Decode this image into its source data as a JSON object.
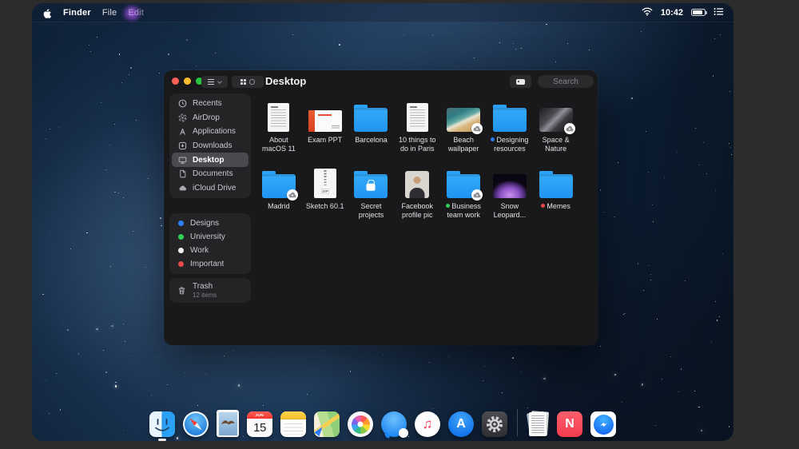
{
  "menu_bar": {
    "left_items": [
      {
        "label": "Finder",
        "bold": true
      },
      {
        "label": "File"
      },
      {
        "label": "Edit"
      }
    ],
    "time": "10:42"
  },
  "finder_window": {
    "title": "Desktop",
    "toolbar": {
      "search_placeholder": "Search"
    },
    "sidebar": {
      "places": [
        {
          "label": "Recents",
          "icon": "clock-icon"
        },
        {
          "label": "AirDrop",
          "icon": "airdrop-icon"
        },
        {
          "label": "Applications",
          "icon": "applications-icon"
        },
        {
          "label": "Downloads",
          "icon": "downloads-icon"
        },
        {
          "label": "Desktop",
          "icon": "desktop-icon",
          "selected": true
        },
        {
          "label": "Documents",
          "icon": "documents-icon"
        },
        {
          "label": "iCloud Drive",
          "icon": "icloud-icon"
        }
      ],
      "tags": [
        {
          "label": "Designs",
          "color": "#2c7ef8"
        },
        {
          "label": "University",
          "color": "#30d158"
        },
        {
          "label": "Work",
          "color": "#f2f2f4"
        },
        {
          "label": "Important",
          "color": "#e8484a"
        }
      ],
      "trash": {
        "label": "Trash",
        "count": "12 items",
        "icon": "trash-icon"
      }
    },
    "files": [
      {
        "label": "About macOS 11",
        "type": "document"
      },
      {
        "label": "Exam PPT",
        "type": "presentation"
      },
      {
        "label": "Barcelona",
        "type": "folder"
      },
      {
        "label": "10 things to do in Paris",
        "type": "document"
      },
      {
        "label": "Beach wallpaper",
        "type": "image-beach",
        "badge": "icloud-download"
      },
      {
        "label": "Designing resources",
        "type": "folder",
        "tag": "#2c7ef8"
      },
      {
        "label": "Space & Nature",
        "type": "image-space",
        "badge": "icloud-download"
      },
      {
        "label": "Madrid",
        "type": "folder",
        "badge": "icloud-download"
      },
      {
        "label": "Sketch 60.1",
        "type": "zip"
      },
      {
        "label": "Secret projects",
        "type": "folder-lock"
      },
      {
        "label": "Facebook profile pic",
        "type": "image-person"
      },
      {
        "label": "Business team work",
        "type": "folder",
        "badge": "icloud-download",
        "tag": "#30d158"
      },
      {
        "label": "Snow Leopard...",
        "type": "image-aurora"
      },
      {
        "label": "Memes",
        "type": "folder",
        "tag": "#e8484a"
      }
    ]
  },
  "dock": {
    "items": [
      {
        "name": "finder",
        "running": true
      },
      {
        "name": "safari"
      },
      {
        "name": "photo-bird"
      },
      {
        "name": "calendar",
        "month": "JUN",
        "day": "15"
      },
      {
        "name": "notes"
      },
      {
        "name": "maps"
      },
      {
        "name": "photos"
      },
      {
        "name": "messages"
      },
      {
        "name": "music"
      },
      {
        "name": "app-store"
      },
      {
        "name": "settings"
      },
      {
        "name": "separator"
      },
      {
        "name": "documents-stack"
      },
      {
        "name": "news"
      },
      {
        "name": "messenger"
      }
    ]
  },
  "colors": {
    "folder_blue": "#2ba2f6",
    "window_bg": "#19191b",
    "frame_bg": "#2c2c2c"
  }
}
